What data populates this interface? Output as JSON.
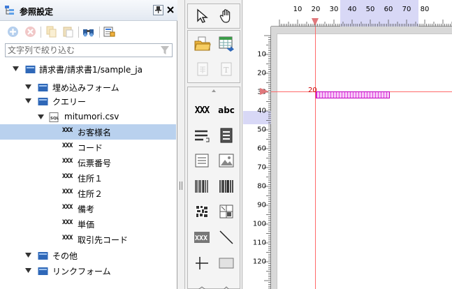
{
  "panel": {
    "title": "参照設定",
    "pin_label": "ᵖ",
    "close_label": "×"
  },
  "filter": {
    "placeholder": "文字列で絞り込む"
  },
  "tree": {
    "root": "請求書/請求書1/sample_ja",
    "embedded_form": "埋め込みフォーム",
    "query": "クエリー",
    "csv": "mitumori.csv",
    "csv_badge": "SQL",
    "field_badge": "XXX",
    "fields": [
      "お客様名",
      "コード",
      "伝票番号",
      "住所１",
      "住所２",
      "備考",
      "単価",
      "取引先コード"
    ],
    "selected_field": "お客様名",
    "other": "その他",
    "link_form": "リンクフォーム"
  },
  "palette": {
    "text_field": "XXX",
    "label": "abc"
  },
  "ruler": {
    "horizontal": [
      "10",
      "20",
      "30",
      "40",
      "50",
      "60",
      "70",
      "80"
    ],
    "vertical": [
      "10",
      "20",
      "30",
      "40",
      "50",
      "60",
      "70",
      "80",
      "90",
      "100",
      "110",
      "120"
    ]
  },
  "canvas": {
    "field_label": "20"
  },
  "colors": {
    "selection": "#b9d1ee",
    "guide": "#ff6a6a",
    "field": "#e040e0"
  }
}
